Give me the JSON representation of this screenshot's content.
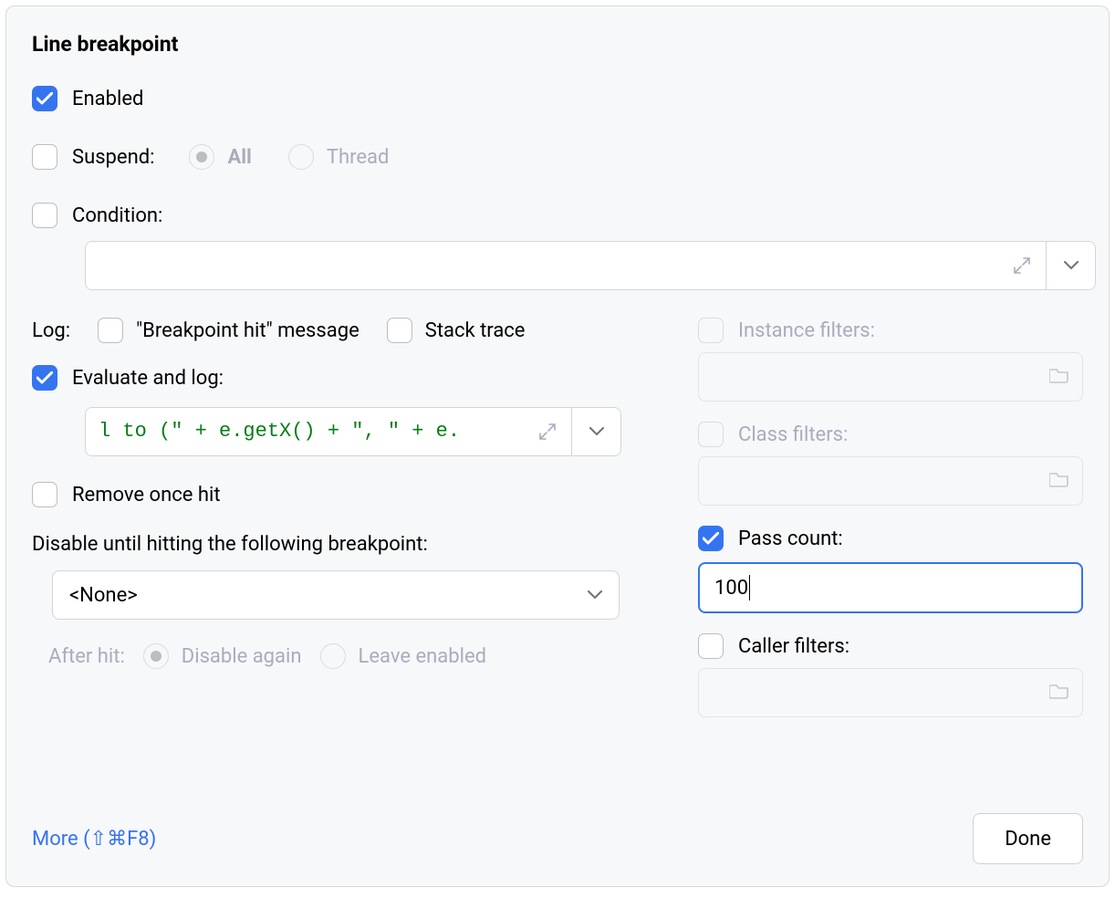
{
  "title": "Line breakpoint",
  "enabled": {
    "label": "Enabled",
    "checked": true
  },
  "suspend": {
    "label": "Suspend:",
    "checked": false,
    "options": {
      "all": "All",
      "thread": "Thread"
    },
    "selected": "all"
  },
  "condition": {
    "label": "Condition:",
    "checked": false,
    "value": ""
  },
  "log": {
    "label": "Log:",
    "hit_message": {
      "label": "\"Breakpoint hit\" message",
      "checked": false
    },
    "stack_trace": {
      "label": "Stack trace",
      "checked": false
    }
  },
  "evaluate": {
    "label": "Evaluate and log:",
    "checked": true,
    "code_visible": "l to (\" + e.getX() + \", \" + e."
  },
  "remove_once_hit": {
    "label": "Remove once hit",
    "checked": false
  },
  "disable_until": {
    "label": "Disable until hitting the following breakpoint:",
    "selected": "<None>",
    "after_hit_label": "After hit:",
    "disable_again": "Disable again",
    "leave_enabled": "Leave enabled"
  },
  "instance_filters": {
    "label": "Instance filters:",
    "checked": false,
    "enabled": false
  },
  "class_filters": {
    "label": "Class filters:",
    "checked": false,
    "enabled": false
  },
  "pass_count": {
    "label": "Pass count:",
    "checked": true,
    "value": "100"
  },
  "caller_filters": {
    "label": "Caller filters:",
    "checked": false,
    "enabled": true
  },
  "footer": {
    "more_link": "More (⇧⌘F8)",
    "done": "Done"
  }
}
